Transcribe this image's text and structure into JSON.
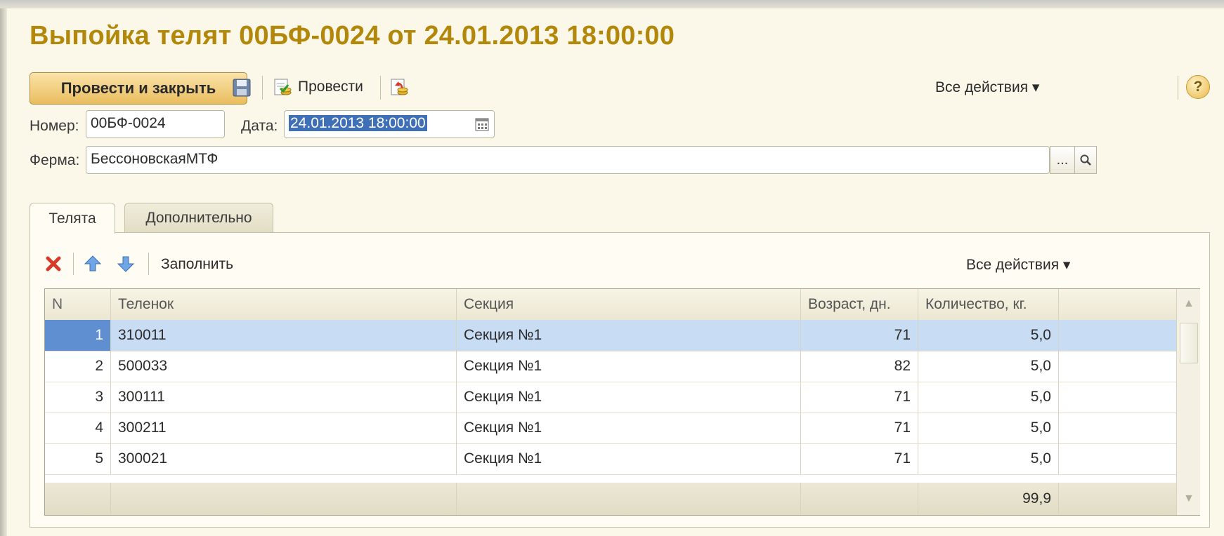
{
  "window": {
    "title": "Выпойка телят 00БФ-0024 от 24.01.2013 18:00:00"
  },
  "toolbar": {
    "post_and_close_label": "Провести и закрыть",
    "save_icon": "floppy-disk-icon",
    "post_label": "Провести",
    "all_actions_label": "Все действия ▾",
    "help_label": "?"
  },
  "fields": {
    "number_label": "Номер:",
    "number_value": "00БФ-0024",
    "date_label": "Дата:",
    "date_value": "24.01.2013 18:00:00",
    "farm_label": "Ферма:",
    "farm_value": "БессоновскаяМТФ",
    "farm_choose_label": "...",
    "farm_search_label": "Q"
  },
  "tabs": [
    {
      "label": "Телята",
      "active": true
    },
    {
      "label": "Дополнительно",
      "active": false
    }
  ],
  "table_toolbar": {
    "fill_label": "Заполнить",
    "all_actions_label": "Все действия ▾"
  },
  "table": {
    "columns": [
      "N",
      "Теленок",
      "Секция",
      "Возраст, дн.",
      "Количество, кг."
    ],
    "rows": [
      {
        "n": "1",
        "calf": "310011",
        "section": "Секция №1",
        "age": "71",
        "qty": "5,0"
      },
      {
        "n": "2",
        "calf": "500033",
        "section": "Секция №1",
        "age": "82",
        "qty": "5,0"
      },
      {
        "n": "3",
        "calf": "300111",
        "section": "Секция №1",
        "age": "71",
        "qty": "5,0"
      },
      {
        "n": "4",
        "calf": "300211",
        "section": "Секция №1",
        "age": "71",
        "qty": "5,0"
      },
      {
        "n": "5",
        "calf": "300021",
        "section": "Секция №1",
        "age": "71",
        "qty": "5,0"
      }
    ],
    "total_qty": "99,9",
    "selected_row": 1
  },
  "colors": {
    "title": "#b3880a",
    "selection": "#3f6fb6",
    "selected_row_bg": "#c8dcf3"
  }
}
